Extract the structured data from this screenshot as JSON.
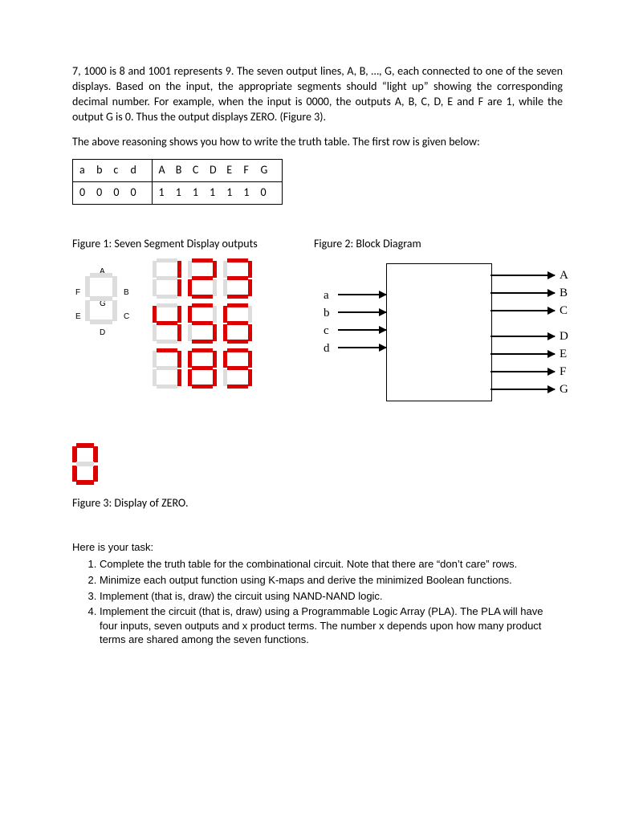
{
  "intro_p1": "7, 1000 is 8 and 1001 represents 9. The seven output lines, A, B, …, G, each connected to one of the seven displays. Based on the input, the appropriate segments should “light up” showing the corresponding decimal number. For example, when the input is 0000, the outputs A, B, C, D, E and F are 1, while the output G is 0. Thus the output displays ZERO. (Figure 3).",
  "intro_p2": "The above reasoning shows you how to write the truth table. The first row is given below:",
  "truth_table": {
    "header_inputs": [
      "a",
      "b",
      "c",
      "d"
    ],
    "header_outputs": [
      "A",
      "B",
      "C",
      "D",
      "E",
      "F",
      "G"
    ],
    "row_inputs": [
      "0",
      "0",
      "0",
      "0"
    ],
    "row_outputs": [
      "1",
      "1",
      "1",
      "1",
      "1",
      "1",
      "0"
    ]
  },
  "fig1_caption": "Figure 1: Seven Segment Display outputs",
  "fig2_caption": "Figure 2: Block Diagram",
  "fig3_caption": "Figure 3: Display of ZERO.",
  "seg_labels": {
    "A": "A",
    "B": "B",
    "C": "C",
    "D": "D",
    "E": "E",
    "F": "F",
    "G": "G"
  },
  "block_inputs": [
    "a",
    "b",
    "c",
    "d"
  ],
  "block_outputs": [
    "A",
    "B",
    "C",
    "D",
    "E",
    "F",
    "G"
  ],
  "task_intro": "Here is your task:",
  "tasks": [
    "Complete the truth table for the combinational circuit. Note that there are “don’t care” rows.",
    "Minimize each output function using K-maps and derive the minimized Boolean functions.",
    "Implement (that is, draw) the circuit using NAND-NAND logic.",
    "Implement the circuit (that is, draw) using a Programmable Logic Array (PLA). The PLA will have four inputs, seven outputs and x product terms. The number x depends upon how many product terms are shared among the seven functions."
  ]
}
